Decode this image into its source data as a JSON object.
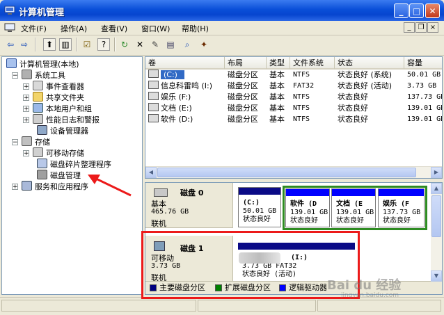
{
  "window": {
    "title": "计算机管理"
  },
  "menu": [
    {
      "label": "文件(F)"
    },
    {
      "label": "操作(A)"
    },
    {
      "label": "查看(V)"
    },
    {
      "label": "窗口(W)"
    },
    {
      "label": "帮助(H)"
    }
  ],
  "mdi_controls": {
    "minimize": "_",
    "restore": "❐",
    "close": "×"
  },
  "tree": {
    "root": "计算机管理(本地)",
    "system_tools": "系统工具",
    "event_viewer": "事件查看器",
    "shared_folders": "共享文件夹",
    "local_users": "本地用户和组",
    "perf_logs": "性能日志和警报",
    "device_manager": "设备管理器",
    "storage": "存储",
    "removable": "可移动存储",
    "defrag": "磁盘碎片整理程序",
    "disk_mgmt": "磁盘管理",
    "services": "服务和应用程序"
  },
  "volume_table": {
    "headers": [
      "卷",
      "布局",
      "类型",
      "文件系统",
      "状态",
      "容量"
    ],
    "rows": [
      [
        "(C:)",
        "磁盘分区",
        "基本",
        "NTFS",
        "状态良好 (系统)",
        "50.01 GB"
      ],
      [
        "信息科雷鸣 (I:)",
        "磁盘分区",
        "基本",
        "FAT32",
        "状态良好 (活动)",
        "3.73 GB"
      ],
      [
        "娱乐 (F:)",
        "磁盘分区",
        "基本",
        "NTFS",
        "状态良好",
        "137.73 GB"
      ],
      [
        "文档 (E:)",
        "磁盘分区",
        "基本",
        "NTFS",
        "状态良好",
        "139.01 GB"
      ],
      [
        "软件 (D:)",
        "磁盘分区",
        "基本",
        "NTFS",
        "状态良好",
        "139.01 GB"
      ]
    ]
  },
  "disk0": {
    "name": "磁盘 0",
    "type": "基本",
    "size": "465.76 GB",
    "status": "联机",
    "partitions": [
      {
        "title": "(C:)",
        "size": "50.01 GB",
        "state": "状态良好"
      },
      {
        "title": "软件 (D",
        "size": "139.01 GB",
        "state": "状态良好"
      },
      {
        "title": "文档 (E",
        "size": "139.01 GB",
        "state": "状态良好"
      },
      {
        "title": "娱乐 (F",
        "size": "137.73 GB",
        "state": "状态良好"
      }
    ]
  },
  "disk1": {
    "name": "磁盘 1",
    "type": "可移动",
    "size": "3.73 GB",
    "status": "联机",
    "partition": {
      "title": "(I:)",
      "size": "3.73 GB FAT32",
      "state": "状态良好 (活动)"
    }
  },
  "legend": [
    {
      "label": "主要磁盘分区",
      "color": "#00007f"
    },
    {
      "label": "扩展磁盘分区",
      "color": "#008000"
    },
    {
      "label": "逻辑驱动器",
      "color": "#0000ff"
    }
  ],
  "colors": {
    "primary_bar": "#0a0a86",
    "extended_border": "#2e8b22",
    "annotation": "#ec1a1a"
  },
  "watermark": {
    "text": "Bai du 经验",
    "sub": "jingyan.baidu.com"
  }
}
